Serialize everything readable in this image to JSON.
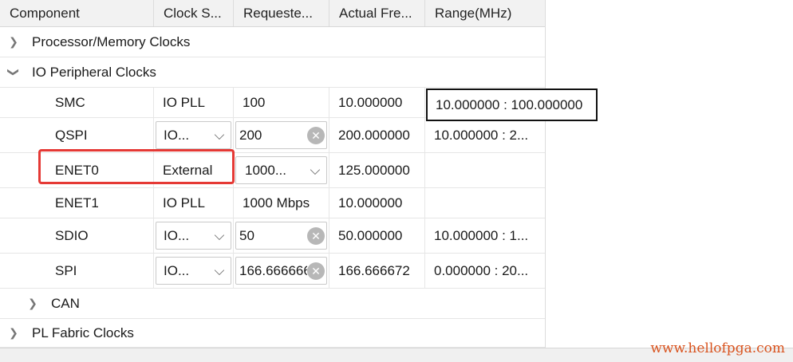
{
  "columns": [
    "Component",
    "Clock S...",
    "Requeste...",
    "Actual Fre...",
    "Range(MHz)"
  ],
  "groups": {
    "processor": "Processor/Memory Clocks",
    "io": "IO Peripheral Clocks",
    "can": "CAN",
    "pl": "PL Fabric Clocks"
  },
  "rows": [
    {
      "name": "SMC",
      "source": "IO PLL",
      "requested": "100",
      "actual": "10.000000",
      "range": ""
    },
    {
      "name": "QSPI",
      "source": "IO...",
      "requested": "200",
      "actual": "200.000000",
      "range": "10.000000 : 2..."
    },
    {
      "name": "ENET0",
      "source": "External",
      "requested": "1000...",
      "actual": "125.000000",
      "range": ""
    },
    {
      "name": "ENET1",
      "source": "IO PLL",
      "requested": "1000 Mbps",
      "actual": "10.000000",
      "range": ""
    },
    {
      "name": "SDIO",
      "source": "IO...",
      "requested": "50",
      "actual": "50.000000",
      "range": "10.000000 : 1..."
    },
    {
      "name": "SPI",
      "source": "IO...",
      "requested": "166.666666",
      "actual": "166.666672",
      "range": "0.000000 : 20..."
    }
  ],
  "tooltip": "10.000000 : 100.000000",
  "watermark": "www.hellofpga.com",
  "colors": {
    "highlight": "#e53935",
    "watermark": "#d9531e",
    "header_bg": "#f2f2f2"
  },
  "icons": {
    "expand": "chevron-right-icon",
    "collapse": "chevron-down-icon",
    "clear": "clear-circle-icon",
    "dropdown": "dropdown-arrow-icon"
  }
}
